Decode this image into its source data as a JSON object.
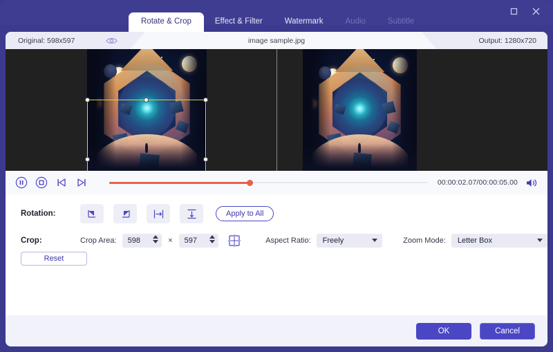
{
  "titlebar": {
    "maximize_icon": "maximize-icon",
    "close_icon": "close-icon"
  },
  "tabs": [
    {
      "label": "Rotate & Crop",
      "state": "active"
    },
    {
      "label": "Effect & Filter",
      "state": "normal"
    },
    {
      "label": "Watermark",
      "state": "normal"
    },
    {
      "label": "Audio",
      "state": "disabled"
    },
    {
      "label": "Subtitle",
      "state": "disabled"
    }
  ],
  "infobar": {
    "original_label": "Original: 598x597",
    "eye_icon": "eye-icon",
    "file_name": "image sample.jpg",
    "output_label": "Output: 1280x720"
  },
  "player": {
    "pause_icon": "pause-icon",
    "stop_icon": "stop-icon",
    "prev_icon": "previous-frame-icon",
    "next_icon": "next-frame-icon",
    "time_label": "00:00:02.07/00:00:05.00",
    "volume_icon": "volume-icon",
    "progress_percent": 44
  },
  "rotation": {
    "label": "Rotation:",
    "buttons": [
      {
        "icon": "rotate-left-icon"
      },
      {
        "icon": "rotate-right-icon"
      },
      {
        "icon": "flip-horizontal-icon"
      },
      {
        "icon": "flip-vertical-icon"
      }
    ],
    "apply_to_all_label": "Apply to All"
  },
  "crop": {
    "label": "Crop:",
    "crop_area_label": "Crop Area:",
    "width_value": "598",
    "height_value": "597",
    "times_symbol": "×",
    "link_icon": "crop-link-icon",
    "aspect_ratio_label": "Aspect Ratio:",
    "aspect_ratio_value": "Freely",
    "zoom_mode_label": "Zoom Mode:",
    "zoom_mode_value": "Letter Box",
    "reset_label": "Reset"
  },
  "footer": {
    "ok_label": "OK",
    "cancel_label": "Cancel"
  },
  "colors": {
    "brand_purple": "#4b46c4",
    "titlebar": "#3f3d92",
    "crop_outline": "#d3d64a",
    "progress": "#e8604c",
    "preview_bg": "#212121"
  }
}
